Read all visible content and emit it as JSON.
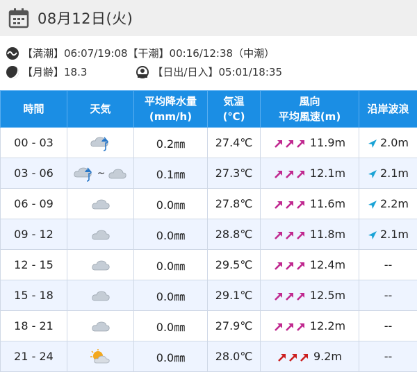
{
  "header": {
    "date": "08月12日(火)"
  },
  "info": {
    "tide_label": "【満潮】",
    "tide_high": "06:07/19:08",
    "low_label": "【干潮】",
    "tide_low": "00:16/12:38",
    "tide_type": "（中潮）",
    "moon_label": "【月齢】",
    "moon_age": "18.3",
    "sun_label": "【日出/日入】",
    "sun_times": "05:01/18:35"
  },
  "table": {
    "headers": {
      "time": "時間",
      "weather": "天気",
      "precip": "平均降水量",
      "precip_unit": "(mm/h)",
      "temp": "気温",
      "temp_unit": "(℃)",
      "wind": "風向",
      "wind_speed": "平均風速(m)",
      "wave": "沿岸波浪"
    },
    "rows": [
      {
        "time": "00 - 03",
        "weather": "cloud-rain-icon",
        "precip": "0.2㎜",
        "temp": "27.4℃",
        "wind": "11.9m",
        "wind_color": "#c0288f",
        "wave": "2.0m"
      },
      {
        "time": "03 - 06",
        "weather": "rain-then-cloud",
        "precip": "0.1㎜",
        "temp": "27.3℃",
        "wind": "12.1m",
        "wind_color": "#c0288f",
        "wave": "2.1m"
      },
      {
        "time": "06 - 09",
        "weather": "cloud-icon",
        "precip": "0.0㎜",
        "temp": "27.8℃",
        "wind": "11.6m",
        "wind_color": "#c0288f",
        "wave": "2.2m"
      },
      {
        "time": "09 - 12",
        "weather": "cloud-icon",
        "precip": "0.0㎜",
        "temp": "28.8℃",
        "wind": "11.8m",
        "wind_color": "#c0288f",
        "wave": "2.1m"
      },
      {
        "time": "12 - 15",
        "weather": "cloud-icon",
        "precip": "0.0㎜",
        "temp": "29.5℃",
        "wind": "12.4m",
        "wind_color": "#c0288f",
        "wave": "--"
      },
      {
        "time": "15 - 18",
        "weather": "cloud-icon",
        "precip": "0.0㎜",
        "temp": "29.1℃",
        "wind": "12.5m",
        "wind_color": "#c0288f",
        "wave": "--"
      },
      {
        "time": "18 - 21",
        "weather": "cloud-icon",
        "precip": "0.0㎜",
        "temp": "27.9℃",
        "wind": "12.2m",
        "wind_color": "#c0288f",
        "wave": "--"
      },
      {
        "time": "21 - 24",
        "weather": "sun-cloud-icon",
        "precip": "0.0㎜",
        "temp": "28.0℃",
        "wind": "9.2m",
        "wind_color": "#cc1f1f",
        "wave": "--"
      }
    ]
  },
  "colors": {
    "header_blue": "#1b8ee4",
    "row_alt": "#eef4ff",
    "wave_arrow": "#1aa3d6"
  }
}
